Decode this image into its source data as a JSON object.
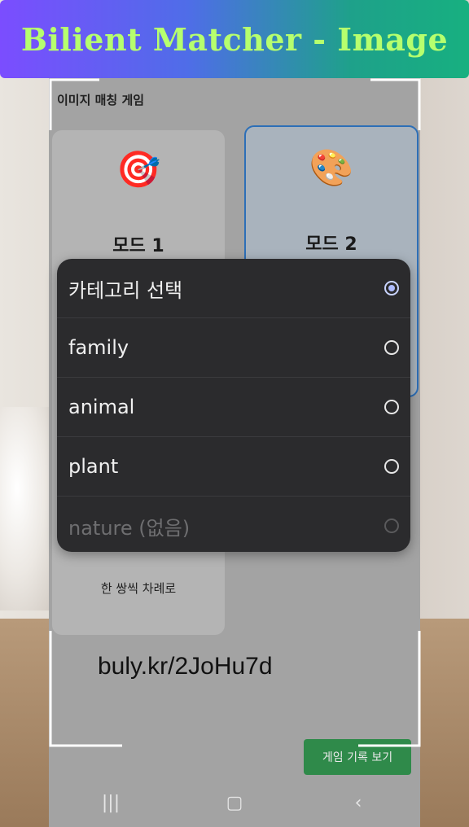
{
  "banner": {
    "title": "Bilient Matcher - Image"
  },
  "app": {
    "title": "이미지 매칭 게임"
  },
  "modes": [
    {
      "icon": "🎯",
      "label": "모드 1",
      "subtitle": "한 쌍씩 차례로"
    },
    {
      "icon": "🎨",
      "label": "모드 2"
    }
  ],
  "record_button": "게임 기록 보기",
  "overlay_url": "buly.kr/2JoHu7d",
  "dialog": {
    "options": [
      {
        "label": "카테고리 선택",
        "selected": true,
        "enabled": true
      },
      {
        "label": "family",
        "selected": false,
        "enabled": true
      },
      {
        "label": "animal",
        "selected": false,
        "enabled": true
      },
      {
        "label": "plant",
        "selected": false,
        "enabled": true
      },
      {
        "label": "nature (없음)",
        "selected": false,
        "enabled": false
      }
    ]
  },
  "navbar": {
    "recents_icon": "recents-icon",
    "home_icon": "home-icon",
    "back_icon": "back-icon"
  },
  "colors": {
    "accent": "#2d6fb7",
    "record_button": "#2f8a4a",
    "dialog_bg": "#2b2b2d",
    "banner_text": "#b6ff6e"
  }
}
